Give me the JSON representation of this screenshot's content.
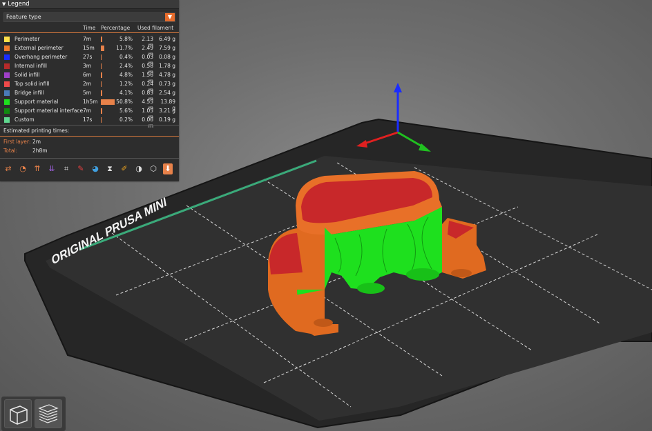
{
  "legend": {
    "title": "Legend",
    "dropdown_value": "Feature type",
    "headers": {
      "time": "Time",
      "percentage": "Percentage",
      "used_filament": "Used filament"
    },
    "rows": [
      {
        "name": "Perimeter",
        "color": "#ffe04a",
        "time": "7m",
        "pct_value": 5.8,
        "pct": "5.8%",
        "meters": "2.13 m",
        "grams": "6.49 g"
      },
      {
        "name": "External perimeter",
        "color": "#f07a2a",
        "time": "15m",
        "pct_value": 11.7,
        "pct": "11.7%",
        "meters": "2.49 m",
        "grams": "7.59 g"
      },
      {
        "name": "Overhang perimeter",
        "color": "#1a2cff",
        "time": "27s",
        "pct_value": 0.4,
        "pct": "0.4%",
        "meters": "0.03 m",
        "grams": "0.08 g"
      },
      {
        "name": "Internal infill",
        "color": "#b52a2a",
        "time": "3m",
        "pct_value": 2.4,
        "pct": "2.4%",
        "meters": "0.58 m",
        "grams": "1.78 g"
      },
      {
        "name": "Solid infill",
        "color": "#a040c8",
        "time": "6m",
        "pct_value": 4.8,
        "pct": "4.8%",
        "meters": "1.56 m",
        "grams": "4.78 g"
      },
      {
        "name": "Top solid infill",
        "color": "#f04a4a",
        "time": "2m",
        "pct_value": 1.2,
        "pct": "1.2%",
        "meters": "0.24 m",
        "grams": "0.73 g"
      },
      {
        "name": "Bridge infill",
        "color": "#4a7ab8",
        "time": "5m",
        "pct_value": 4.1,
        "pct": "4.1%",
        "meters": "0.83 m",
        "grams": "2.54 g"
      },
      {
        "name": "Support material",
        "color": "#1ee01e",
        "time": "1h5m",
        "pct_value": 50.8,
        "pct": "50.8%",
        "meters": "4.55 m",
        "grams": "13.89 g"
      },
      {
        "name": "Support material interface",
        "color": "#108a10",
        "time": "7m",
        "pct_value": 5.6,
        "pct": "5.6%",
        "meters": "1.05 m",
        "grams": "3.21 g"
      },
      {
        "name": "Custom",
        "color": "#60d890",
        "time": "17s",
        "pct_value": 0.2,
        "pct": "0.2%",
        "meters": "0.06 m",
        "grams": "0.19 g"
      }
    ],
    "estimated_label": "Estimated printing times:",
    "first_layer_label": "First layer:",
    "first_layer_value": "2m",
    "total_label": "Total:",
    "total_value": "2h8m",
    "toolbar_icons": [
      "travel-icon",
      "wipe-icon",
      "retractions-icon",
      "deretractions-icon",
      "seams-icon",
      "tool-changes-icon",
      "color-changes-icon",
      "pause-prints-icon",
      "custom-gcode-icon",
      "center-of-gravity-icon",
      "shells-icon",
      "tool-marker-icon"
    ]
  },
  "bed": {
    "label": "ORIGINAL PRUSA MINI"
  },
  "colors": {
    "accent": "#e8824a",
    "bed": "#2a2a2a",
    "external_perimeter": "#f07a2a",
    "support": "#1ee01e",
    "top_solid": "#c8282a"
  },
  "views": [
    "3d-view-icon",
    "preview-layers-icon"
  ]
}
